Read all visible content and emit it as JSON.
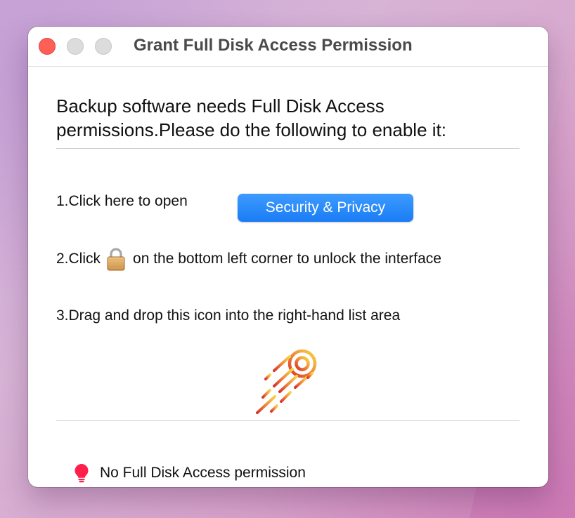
{
  "window": {
    "title": "Grant Full Disk Access Permission"
  },
  "intro": {
    "line1": "Backup software needs Full Disk Access",
    "line2": "permissions.Please do the following to enable it:"
  },
  "steps": {
    "step1_text": "1.Click here to open",
    "step1_button": "Security & Privacy",
    "step2_prefix": "2.Click",
    "step2_suffix": "on the bottom left corner to unlock the interface",
    "step3_text": "3.Drag and drop this icon into the right-hand list area"
  },
  "status": {
    "text": "No Full Disk Access permission",
    "icon": "lightbulb-icon",
    "color": "#ff1f4b"
  },
  "colors": {
    "accent": "#1a7cf5",
    "close": "#fe5f57",
    "comet_start": "#f7c948",
    "comet_end": "#d9342b"
  },
  "icons": {
    "lock": "padlock-icon",
    "app": "comet-icon"
  }
}
